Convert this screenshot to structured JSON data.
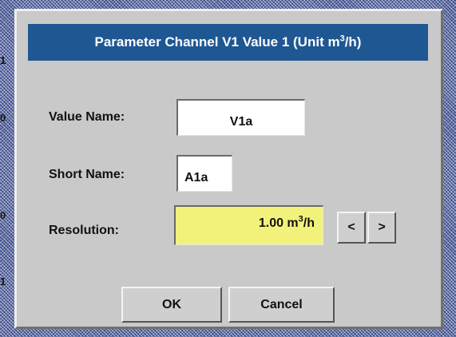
{
  "background": {
    "fragments": [
      "1",
      "0",
      "0",
      "1"
    ]
  },
  "dialog": {
    "title_main": "Parameter Channel V1 Value 1 (Unit m",
    "title_exp": "3",
    "title_end": "/h)",
    "value_name_label": "Value Name:",
    "value_name": "V1a",
    "short_name_label": "Short Name:",
    "short_name": "A1a",
    "resolution_label": "Resolution:",
    "resolution_value": "1.00 m",
    "resolution_exp": "3",
    "resolution_end": "/h",
    "decrease_label": "<",
    "increase_label": ">",
    "ok_label": "OK",
    "cancel_label": "Cancel"
  }
}
